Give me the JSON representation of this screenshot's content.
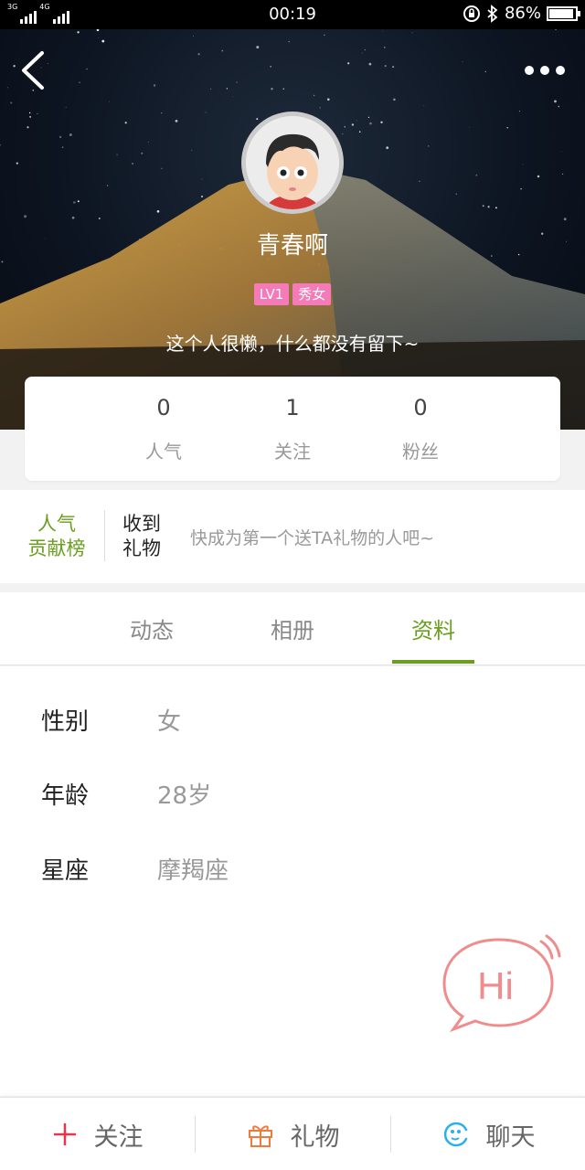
{
  "status_bar": {
    "network_left": "3G",
    "network_right": "4G",
    "time": "00:19",
    "battery": "86%",
    "battery_level": 0.86
  },
  "profile": {
    "username": "青春啊",
    "badges": [
      "LV1",
      "秀女"
    ],
    "bio": "这个人很懒，什么都没有留下~"
  },
  "stats": [
    {
      "value": "0",
      "label": "人气"
    },
    {
      "value": "1",
      "label": "关注"
    },
    {
      "value": "0",
      "label": "粉丝"
    }
  ],
  "gift_rank": {
    "title_line1": "人气",
    "title_line2": "贡献榜",
    "received_line1": "收到",
    "received_line2": "礼物",
    "hint": "快成为第一个送TA礼物的人吧~"
  },
  "tabs": [
    {
      "label": "动态"
    },
    {
      "label": "相册"
    },
    {
      "label": "资料",
      "active": true
    }
  ],
  "info": [
    {
      "key": "性别",
      "value": "女"
    },
    {
      "key": "年龄",
      "value": "28岁"
    },
    {
      "key": "星座",
      "value": "摩羯座"
    }
  ],
  "hi_button": {
    "label": "Hi"
  },
  "bottom_bar": {
    "follow": "关注",
    "gift": "礼物",
    "chat": "聊天"
  },
  "colors": {
    "accent_green": "#6a9e1f",
    "badge_pink": "#f47ab8",
    "hi_coral": "#f08c8c",
    "follow_red": "#e8334a",
    "gift_orange": "#f07a3c",
    "chat_blue": "#2ab0e8"
  },
  "icons": {
    "back": "chevron-left-icon",
    "more": "more-dots-icon",
    "follow": "plus-icon",
    "gift": "gift-icon",
    "chat": "chat-face-icon",
    "hi": "hi-speech-bubble-icon"
  }
}
